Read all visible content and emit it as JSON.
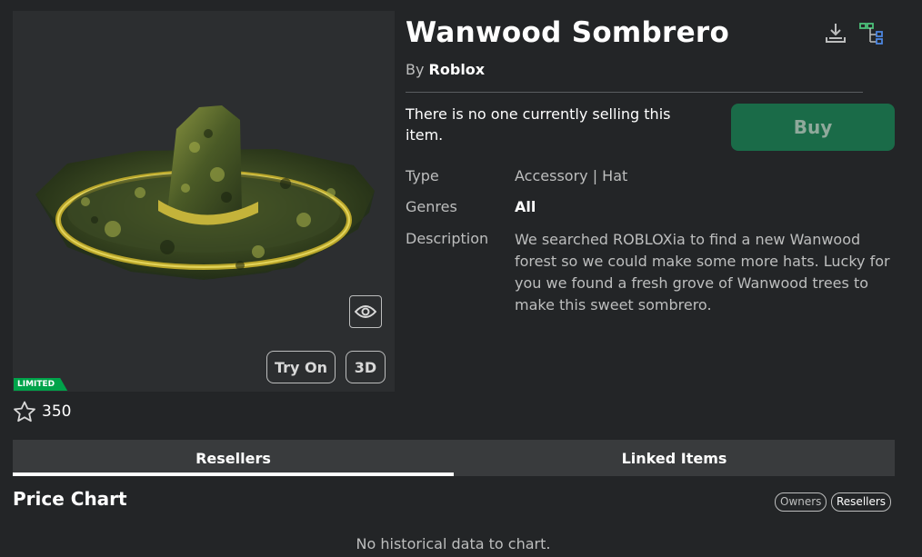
{
  "item": {
    "title": "Wanwood Sombrero",
    "by_prefix": "By",
    "creator": "Roblox",
    "no_seller_text": "There is no one currently selling this item.",
    "buy_label": "Buy",
    "limited_badge": "LIMITED",
    "favorites": "350"
  },
  "thumbnail": {
    "try_on_label": "Try On",
    "three_d_label": "3D",
    "preview_icon": "eye-icon"
  },
  "details": {
    "type_label": "Type",
    "type_value": "Accessory | Hat",
    "genres_label": "Genres",
    "genres_value": "All",
    "description_label": "Description",
    "description_value": "We searched ROBLOXia to find a new Wanwood forest so we could make some more hats. Lucky for you we found a fresh grove of Wanwood trees to make this sweet sombrero."
  },
  "top_icons": [
    "download-icon",
    "hierarchy-icon"
  ],
  "tabs": [
    {
      "label": "Resellers",
      "active": true
    },
    {
      "label": "Linked Items",
      "active": false
    }
  ],
  "price_chart": {
    "title": "Price Chart",
    "toggle_owners": "Owners",
    "toggle_resellers": "Resellers",
    "empty_text": "No historical data to chart."
  },
  "colors": {
    "background": "#232527",
    "buy_button": "#1a6b48",
    "limited_badge": "#00a34a"
  }
}
